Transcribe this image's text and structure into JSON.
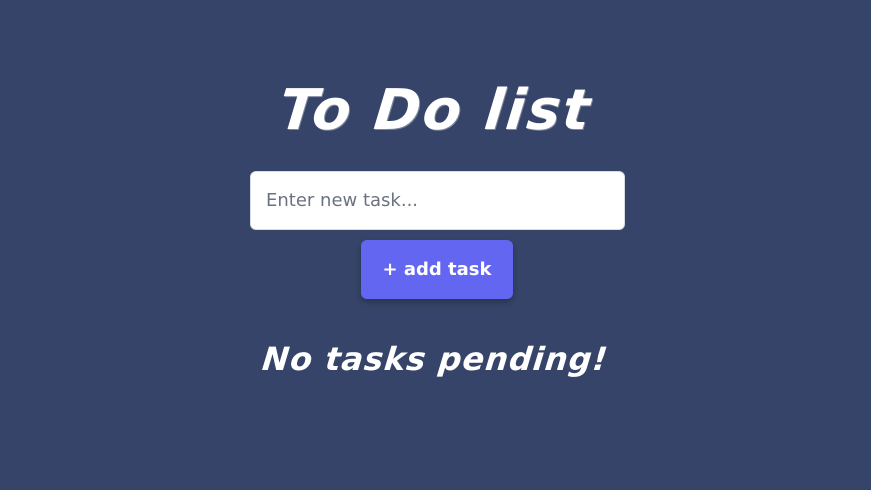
{
  "app": {
    "title": "To Do list"
  },
  "input": {
    "placeholder": "Enter new task...",
    "value": ""
  },
  "actions": {
    "add_label": "+ add task"
  },
  "status": {
    "message": "No tasks pending!"
  },
  "colors": {
    "background": "#354468",
    "accent": "#6366f1",
    "text": "#ffffff"
  }
}
